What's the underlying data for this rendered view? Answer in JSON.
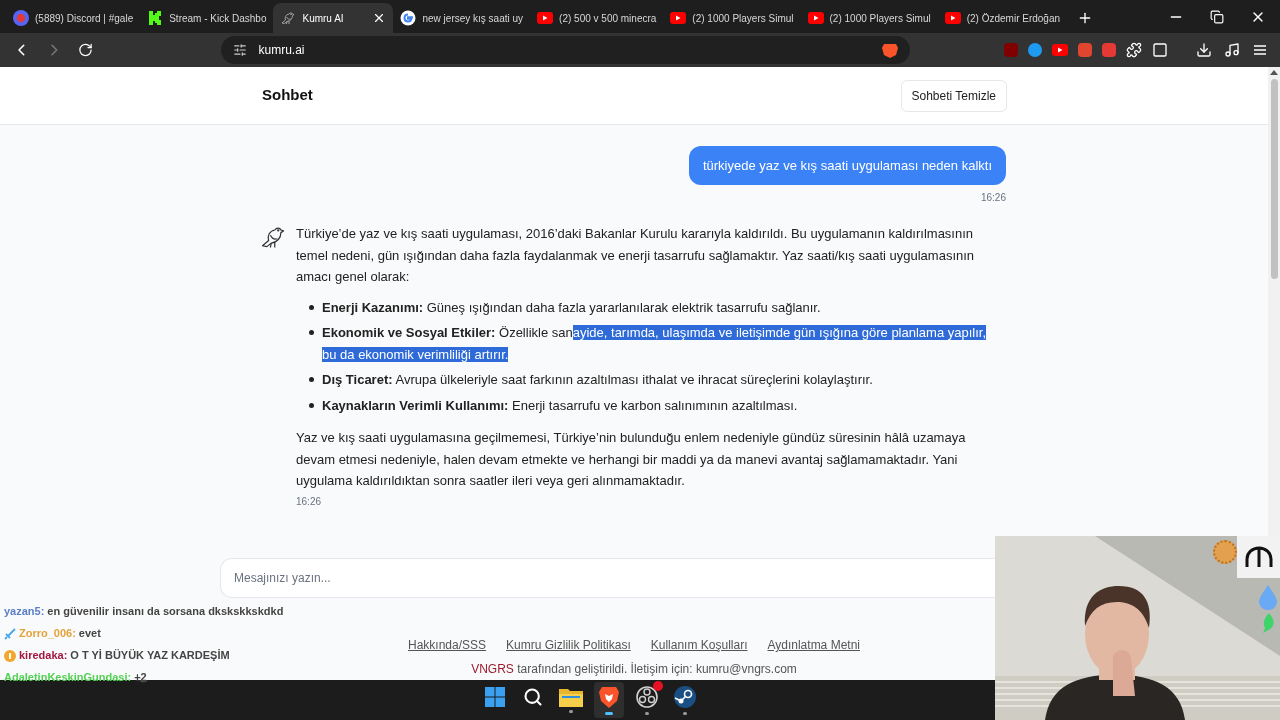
{
  "browser": {
    "tabs": [
      {
        "title": "(5889) Discord | #gale",
        "selected": false
      },
      {
        "title": "Stream - Kick Dashbo",
        "selected": false
      },
      {
        "title": "Kumru AI",
        "selected": true
      },
      {
        "title": "new jersey kış saati uy",
        "selected": false
      },
      {
        "title": "(2) 500 v 500 minecra",
        "selected": false
      },
      {
        "title": "(2) 1000 Players Simul",
        "selected": false
      },
      {
        "title": "(2) 1000 Players Simul",
        "selected": false
      },
      {
        "title": "(2) Özdemir Erdoğan",
        "selected": false
      }
    ],
    "address": "kumru.ai"
  },
  "header": {
    "title": "Sohbet",
    "clear_button": "Sohbeti Temizle"
  },
  "messages": [
    {
      "kind": "user",
      "text": "türkiyede yaz ve kış saati uygulaması neden kalktı",
      "time": "16:26"
    },
    {
      "kind": "bot",
      "intro": "Türkiye’de yaz ve kış saati uygulaması, 2016’daki Bakanlar Kurulu kararıyla kaldırıldı. Bu uygulamanın kaldırılmasının temel nedeni, gün ışığından daha fazla faydalanmak ve enerji tasarrufu sağlamaktır. Yaz saati/kış saati uygulamasının amacı genel olarak:",
      "bullets": [
        {
          "term": "Enerji Kazanımı:",
          "parts": [
            {
              "text": " Güneş ışığından daha fazla yararlanılarak elektrik tasarrufu sağlanır.",
              "selected": false
            }
          ]
        },
        {
          "term": "Ekonomik ve Sosyal Etkiler:",
          "parts": [
            {
              "text": " Özellikle san",
              "selected": false
            },
            {
              "text": "ayide, tarımda, ulaşımda ve iletişimde gün ışığına göre planlama yapılır, bu da ekonomik verimliliği artırır.",
              "selected": true
            }
          ]
        },
        {
          "term": "Dış Ticaret:",
          "parts": [
            {
              "text": " Avrupa ülkeleriyle saat farkının azaltılması ithalat ve ihracat süreçlerini kolaylaştırır.",
              "selected": false
            }
          ]
        },
        {
          "term": "Kaynakların Verimli Kullanımı:",
          "parts": [
            {
              "text": " Enerji tasarrufu ve karbon salınımının azaltılması.",
              "selected": false
            }
          ]
        }
      ],
      "outro": "Yaz ve kış saati uygulamasına geçilmemesi, Türkiye’nin bulunduğu enlem nedeniyle gündüz süresinin hâlâ uzamaya devam etmesi nedeniyle, halen devam etmekte ve herhangi bir maddi ya da manevi avantaj sağlamamaktadır. Yani uygulama kaldırıldıktan sonra saatler ileri veya geri alınmamaktadır.",
      "time": "16:26"
    }
  ],
  "composer": {
    "placeholder": "Mesajınızı yazın..."
  },
  "footer": {
    "links": [
      "Hakkında/SSS",
      "Kumru Gizlilik Politikası",
      "Kullanım Koşulları",
      "Aydınlatma Metni"
    ],
    "credit_brand": "VNGRS",
    "credit_text": "tarafından geliştirildi. İletişim için: kumru@vngrs.com"
  },
  "stream_chat": [
    {
      "user": "yazan5:",
      "message": "en güvenilir insanı da sorsana dkskskkskdkd",
      "color": "#5b7fc4"
    },
    {
      "user": "Zorro_006:",
      "message": "evet",
      "color": "#e3a33a"
    },
    {
      "user": "kiredaka:",
      "message": "O T Yİ BÜYÜK YAZ KARDEŞİM",
      "color": "#a3163f"
    },
    {
      "user": "AdaletinKeskinGundasi:",
      "message": "+2",
      "color": "#52d152"
    }
  ],
  "taskbar": [
    {
      "kind": "start",
      "selected": false,
      "running": false
    },
    {
      "kind": "search",
      "selected": false,
      "running": false
    },
    {
      "kind": "files",
      "selected": false,
      "running": true
    },
    {
      "kind": "browser",
      "selected": true,
      "running": true
    },
    {
      "kind": "obs",
      "selected": false,
      "running": true,
      "notification": true
    },
    {
      "kind": "steam",
      "selected": false,
      "running": true
    }
  ]
}
